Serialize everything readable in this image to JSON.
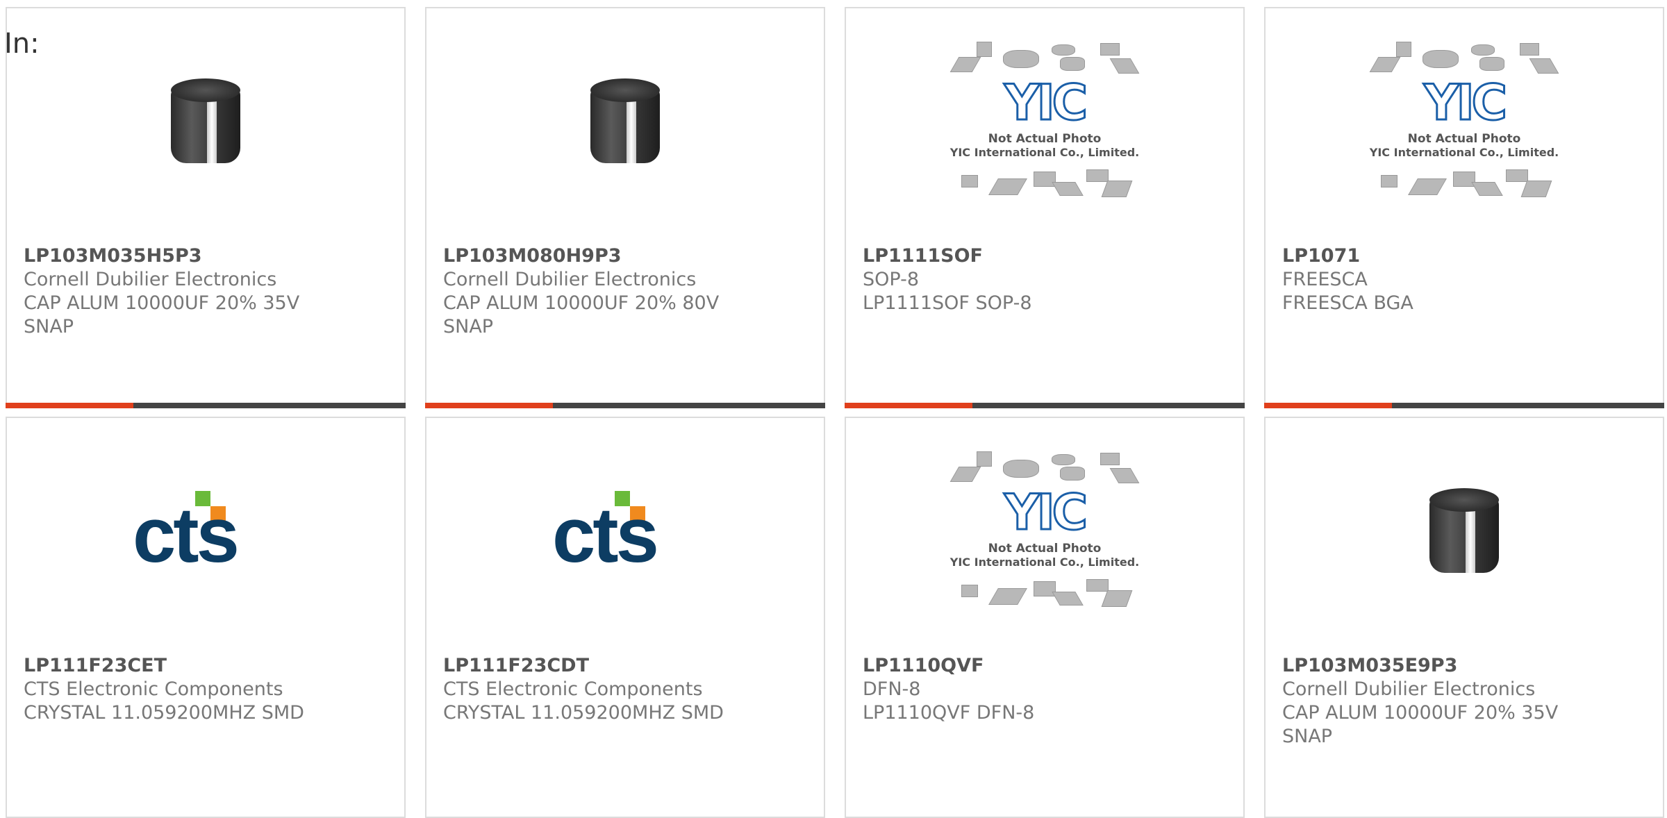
{
  "filter_label": "In:",
  "cards": [
    {
      "image": "capacitor",
      "part": "LP103M035H5P3",
      "lines": [
        "Cornell Dubilier Electronics",
        "CAP ALUM 10000UF 20% 35V",
        "SNAP"
      ]
    },
    {
      "image": "capacitor",
      "part": "LP103M080H9P3",
      "lines": [
        "Cornell Dubilier Electronics",
        "CAP ALUM 10000UF 20% 80V",
        "SNAP"
      ]
    },
    {
      "image": "yic",
      "part": "LP1111SOF",
      "lines": [
        "SOP-8",
        "LP1111SOF SOP-8",
        ""
      ]
    },
    {
      "image": "yic",
      "part": "LP1071",
      "lines": [
        "FREESCA",
        "FREESCA BGA",
        ""
      ]
    },
    {
      "image": "cts",
      "part": "LP111F23CET",
      "lines": [
        "CTS Electronic Components",
        "CRYSTAL 11.059200MHZ SMD",
        ""
      ]
    },
    {
      "image": "cts",
      "part": "LP111F23CDT",
      "lines": [
        "CTS Electronic Components",
        "CRYSTAL 11.059200MHZ SMD",
        ""
      ]
    },
    {
      "image": "yic",
      "part": "LP1110QVF",
      "lines": [
        "DFN-8",
        "LP1110QVF DFN-8",
        ""
      ]
    },
    {
      "image": "capacitor",
      "part": "LP103M035E9P3",
      "lines": [
        "Cornell Dubilier Electronics",
        "CAP ALUM 10000UF 20% 35V",
        "SNAP"
      ]
    }
  ],
  "placeholder_text": {
    "line1": "Not Actual Photo",
    "line2": "YIC International Co., Limited.",
    "logo": "YIC"
  },
  "cts_logo_text": "cts",
  "colors": {
    "accent": "#e0401c",
    "bar": "#444444",
    "border": "#dcdcdc"
  }
}
